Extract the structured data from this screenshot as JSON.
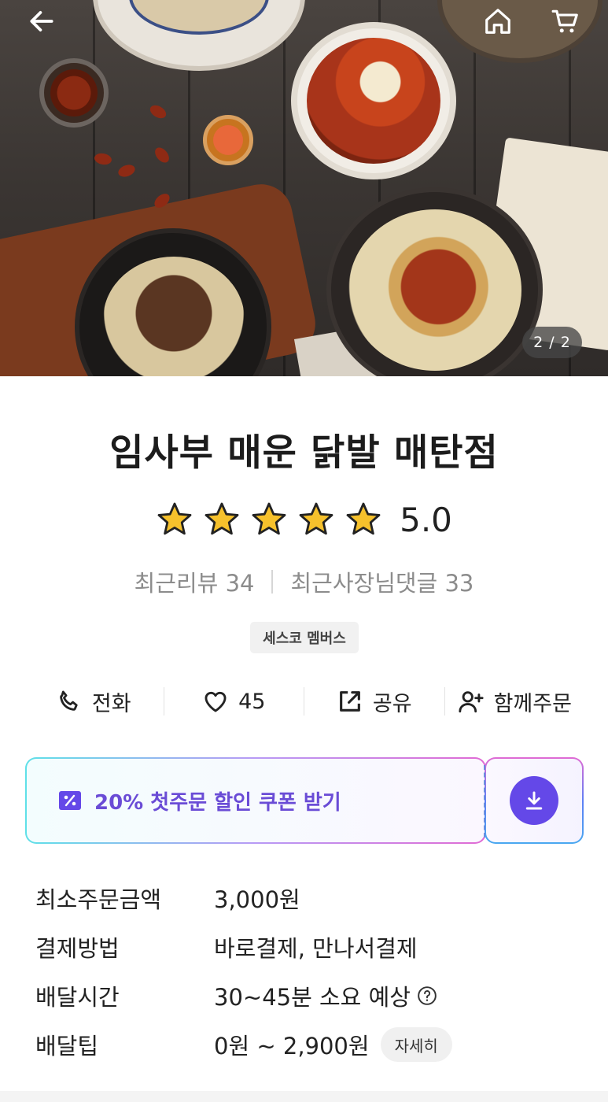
{
  "hero": {
    "image_alt": "spicy chicken feet dishes",
    "page_indicator": "2 / 2",
    "icons": {
      "back": "back-arrow-icon",
      "home": "home-icon",
      "cart": "cart-icon"
    }
  },
  "store": {
    "name": "임사부 매운 닭발 매탄점",
    "rating": "5.0",
    "star_count": 5,
    "recent_reviews_label": "최근리뷰 34",
    "recent_owner_replies_label": "최근사장님댓글 33",
    "member_badge": "세스코 멤버스"
  },
  "actions": {
    "call": "전화",
    "like_count": "45",
    "share": "공유",
    "group_order": "함께주문"
  },
  "coupon": {
    "label": "20% 첫주문 할인 쿠폰 받기",
    "accent_color": "#6448e8"
  },
  "info": {
    "min_order_label": "최소주문금액",
    "min_order_value": "3,000원",
    "payment_label": "결제방법",
    "payment_value": "바로결제, 만나서결제",
    "delivery_time_label": "배달시간",
    "delivery_time_value": "30~45분 소요 예상",
    "delivery_tip_label": "배달팁",
    "delivery_tip_value": "0원 ~ 2,900원",
    "detail_button": "자세히"
  }
}
